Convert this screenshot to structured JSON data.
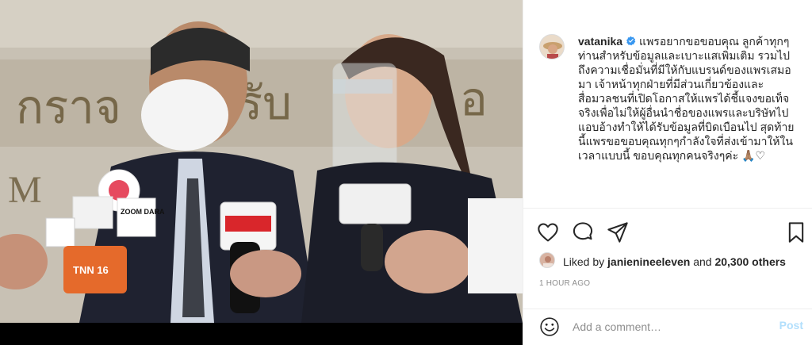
{
  "post": {
    "username": "vatanika",
    "verified": true,
    "caption": "แพรอยากขอขอบคุณ ลูกค้าทุกๆท่านสำหรับข้อมูลและเบาะแสเพิ่มเติม รวมไปถึงความเชื่อมั่นที่มีให้กับแบรนด์ของแพรเสมอมา เจ้าหน้าทุกฝ่ายที่มีส่วนเกี่ยวข้องและสื่อมวลชนที่เปิดโอกาสให้แพรได้ชี้แจงขอเท็จจริงเพื่อไม่ให้ผู้อื่นนำชื่อของแพรและบริษัทไปแอบอ้างทำให้ได้รับข้อมูลที่บิดเบือนไป สุดท้ายนี้แพรขอขอบคุณทุกๆกำลังใจที่ส่งเข้ามาให้ในเวลาแบบนี้ ขอบคุณทุกคนจริงๆค่ะ 🙏🏽♡"
  },
  "likes": {
    "prefix": "Liked by ",
    "user": "janienineeleven",
    "middle": " and ",
    "count": "20,300 others"
  },
  "timestamp": "1 HOUR AGO",
  "comment": {
    "placeholder": "Add a comment…",
    "post_label": "Post"
  },
  "media": {
    "mic_labels": [
      "ZOOM DARA",
      "TNN 16"
    ]
  },
  "colors": {
    "verified": "#3897f0",
    "post_disabled": "#b2dffc",
    "muted": "#8e8e8e"
  },
  "icons": [
    "heart-icon",
    "comment-icon",
    "share-icon",
    "bookmark-icon",
    "emoji-icon",
    "verified-icon"
  ]
}
